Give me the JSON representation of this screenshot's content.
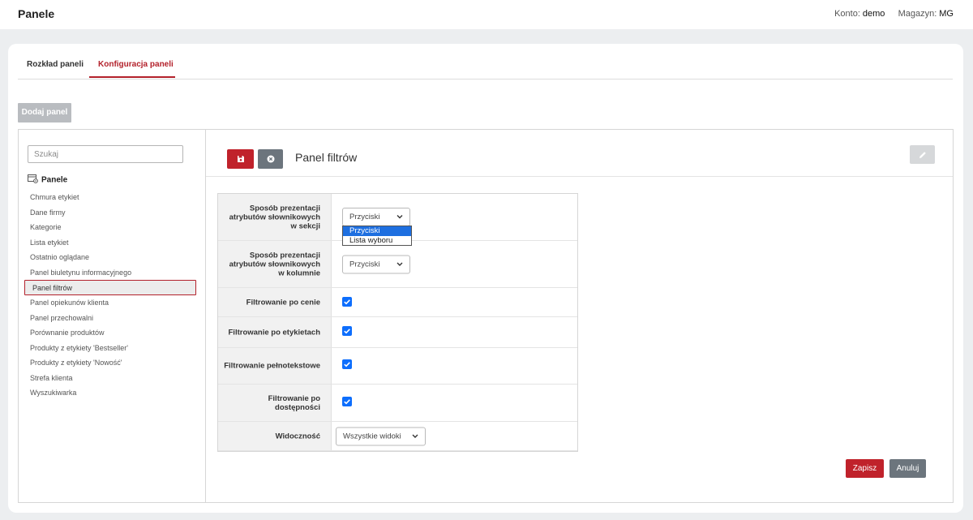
{
  "header": {
    "title": "Panele",
    "account_label": "Konto:",
    "account_value": "demo",
    "warehouse_label": "Magazyn:",
    "warehouse_value": "MG"
  },
  "tabs": [
    {
      "label": "Rozkład paneli",
      "active": false
    },
    {
      "label": "Konfiguracja paneli",
      "active": true
    }
  ],
  "add_panel_label": "Dodaj panel",
  "sidebar": {
    "search_placeholder": "Szukaj",
    "root_label": "Panele",
    "items": [
      "Chmura etykiet",
      "Dane firmy",
      "Kategorie",
      "Lista etykiet",
      "Ostatnio oglądane",
      "Panel biuletynu informacyjnego",
      "Panel filtrów",
      "Panel opiekunów klienta",
      "Panel przechowalni",
      "Porównanie produktów",
      "Produkty z etykiety 'Bestseller'",
      "Produkty z etykiety 'Nowość'",
      "Strefa klienta",
      "Wyszukiwarka"
    ],
    "active_item": "Panel filtrów"
  },
  "content": {
    "panel_title": "Panel filtrów",
    "fields": {
      "presentation_section_label": "Sposób prezentacji atrybutów słownikowych w sekcji",
      "presentation_section_value": "Przyciski",
      "presentation_section_options": [
        "Przyciski",
        "Lista wyboru"
      ],
      "presentation_column_label": "Sposób prezentacji atrybutów słownikowych w kolumnie",
      "presentation_column_value": "Przyciski",
      "filter_price_label": "Filtrowanie po cenie",
      "filter_price_checked": true,
      "filter_labels_label": "Filtrowanie po etykietach",
      "filter_labels_checked": true,
      "filter_fulltext_label": "Filtrowanie pełnotekstowe",
      "filter_fulltext_checked": true,
      "filter_availability_label": "Filtrowanie po dostępności",
      "filter_availability_checked": true,
      "visibility_label": "Widoczność",
      "visibility_value": "Wszystkie widoki"
    },
    "save_label": "Zapisz",
    "cancel_label": "Anuluj"
  },
  "colors": {
    "accent": "#c0222b",
    "secondary": "#6c757d",
    "checkbox": "#0d6efd",
    "dropdown_selected": "#1e6fe0"
  },
  "icons": {
    "save": "floppy-disk-icon",
    "cancel": "close-circle-icon",
    "edit": "pencil-icon",
    "panels_root": "panels-icon",
    "chevron": "chevron-down-icon",
    "check": "checkmark-icon"
  }
}
